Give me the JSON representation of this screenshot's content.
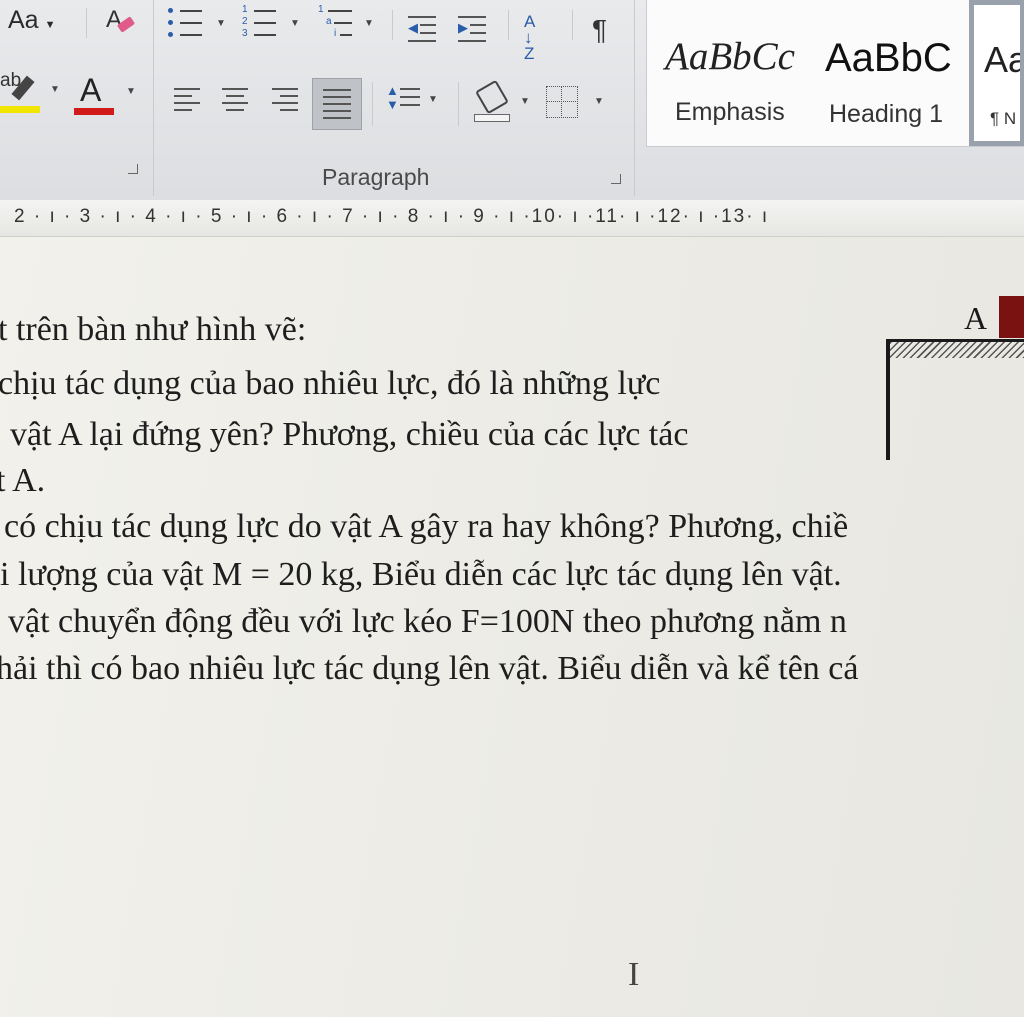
{
  "ribbon": {
    "font_group": {
      "change_case_label": "Aa",
      "highlight_label": "ab",
      "font_color_label": "A"
    },
    "paragraph_group": {
      "label": "Paragraph",
      "sort_label": "A↓Z",
      "show_marks_label": "¶"
    },
    "styles": [
      {
        "preview": "AaBbCc",
        "name": "Emphasis"
      },
      {
        "preview": "AaBbC",
        "name": "Heading 1"
      },
      {
        "preview": "Aa",
        "name": "¶ N"
      }
    ]
  },
  "ruler": {
    "marks": "2 · ı · 3 · ı · 4 · ı · 5 · ı · 6 · ı · 7 · ı · 8 · ı · 9 · ı ·10· ı ·11· ı ·12· ı ·13· ı"
  },
  "document": {
    "lines": [
      "t trên bàn như hình vẽ:",
      "chịu tác dụng của bao nhiêu lực, đó là những lực",
      "vật A lại đứng yên? Phương, chiều của các lực tác",
      "t A.",
      "có chịu tác dụng lực do vật A gây ra hay không? Phương, chiề",
      "i lượng của vật M = 20 kg, Biểu diễn các lực tác dụng lên vật.",
      "vật chuyển động đều với lực kéo F=100N theo phương nằm n",
      "hải thì có bao nhiêu lực tác dụng lên vật. Biểu diễn và kể tên cá"
    ],
    "figure_label": "A",
    "cursor_glyph": "I"
  },
  "colors": {
    "highlight": "#f2e600",
    "font_color": "#d11a1a",
    "block": "#7a1212"
  }
}
